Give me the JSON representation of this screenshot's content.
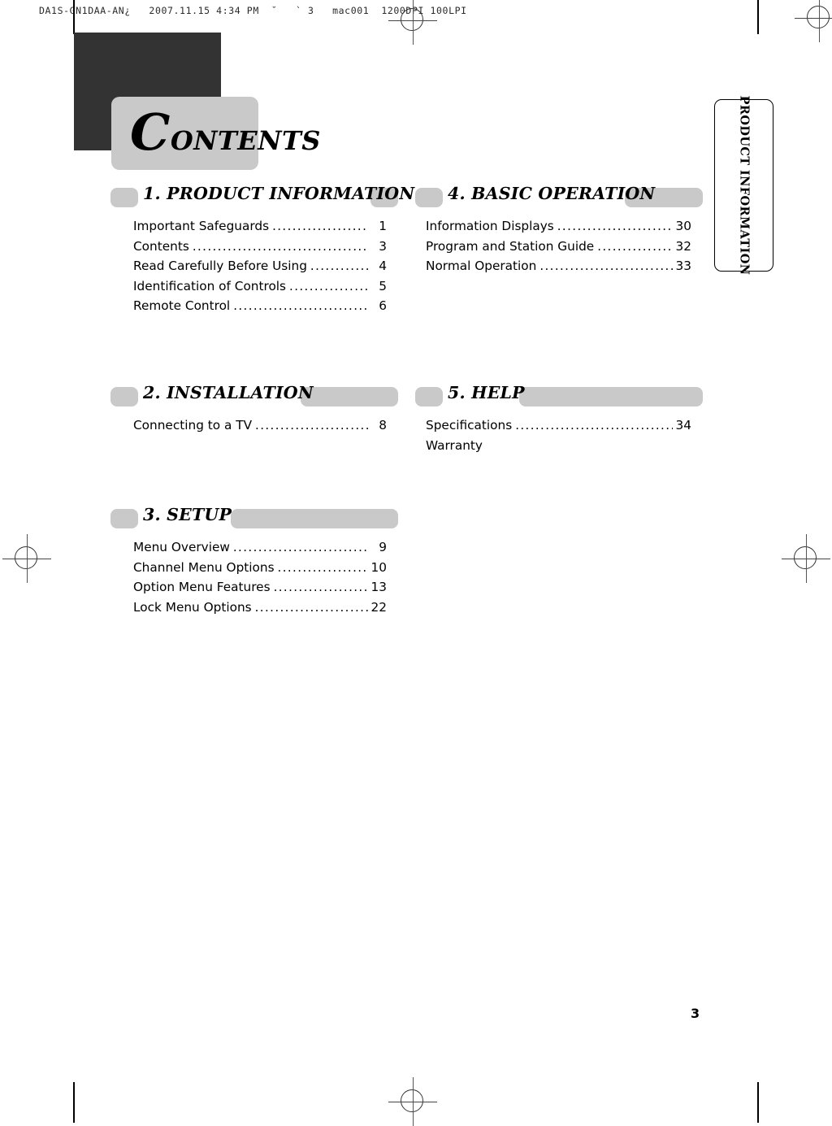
{
  "prepress": {
    "header_text": "DA1S-GN1DAA-AN¿   2007.11.15 4:34 PM  ˘   ` 3   mac001  1200DPI 100LPI"
  },
  "page": {
    "title": "Contents",
    "title_first_letter": "C",
    "title_rest": "ontents",
    "folio": "3",
    "side_tab_label": "PRODUCT INFORMATION",
    "accent_gray": "#c9c9c9",
    "dark_square": "#333333"
  },
  "sections": [
    {
      "heading": "1. PRODUCT INFORMATION",
      "entries": [
        {
          "label": "Important Safeguards",
          "page": "1",
          "leader": "..................................................."
        },
        {
          "label": "Contents",
          "page": "3",
          "leader": "..................................................."
        },
        {
          "label": "Read Carefully Before Using",
          "page": "4",
          "leader": "..................................................."
        },
        {
          "label": "Identification of Controls",
          "page": "5",
          "leader": "..................................................."
        },
        {
          "label": "Remote Control",
          "page": "6",
          "leader": "..................................................."
        }
      ]
    },
    {
      "heading": "2. INSTALLATION",
      "entries": [
        {
          "label": "Connecting to a TV",
          "page": "8",
          "leader": "..................................................."
        }
      ]
    },
    {
      "heading": "3. SETUP",
      "entries": [
        {
          "label": "Menu Overview",
          "page": "9",
          "leader": "..................................................."
        },
        {
          "label": "Channel Menu Options",
          "page": "10",
          "leader": "..................................................."
        },
        {
          "label": "Option Menu Features",
          "page": "13",
          "leader": "..................................................."
        },
        {
          "label": "Lock Menu Options",
          "page": "22",
          "leader": "..................................................."
        }
      ]
    },
    {
      "heading": "4. BASIC OPERATION",
      "entries": [
        {
          "label": "Information Displays",
          "page": "30",
          "leader": "..................................................."
        },
        {
          "label": "Program and Station Guide",
          "page": "32",
          "leader": "..................................................."
        },
        {
          "label": "Normal Operation",
          "page": "33",
          "leader": "..................................................."
        }
      ]
    },
    {
      "heading": "5. HELP",
      "entries": [
        {
          "label": "Specifications",
          "page": "34",
          "leader": "..................................................."
        },
        {
          "label": "Warranty",
          "page": "",
          "leader": ""
        }
      ]
    }
  ]
}
